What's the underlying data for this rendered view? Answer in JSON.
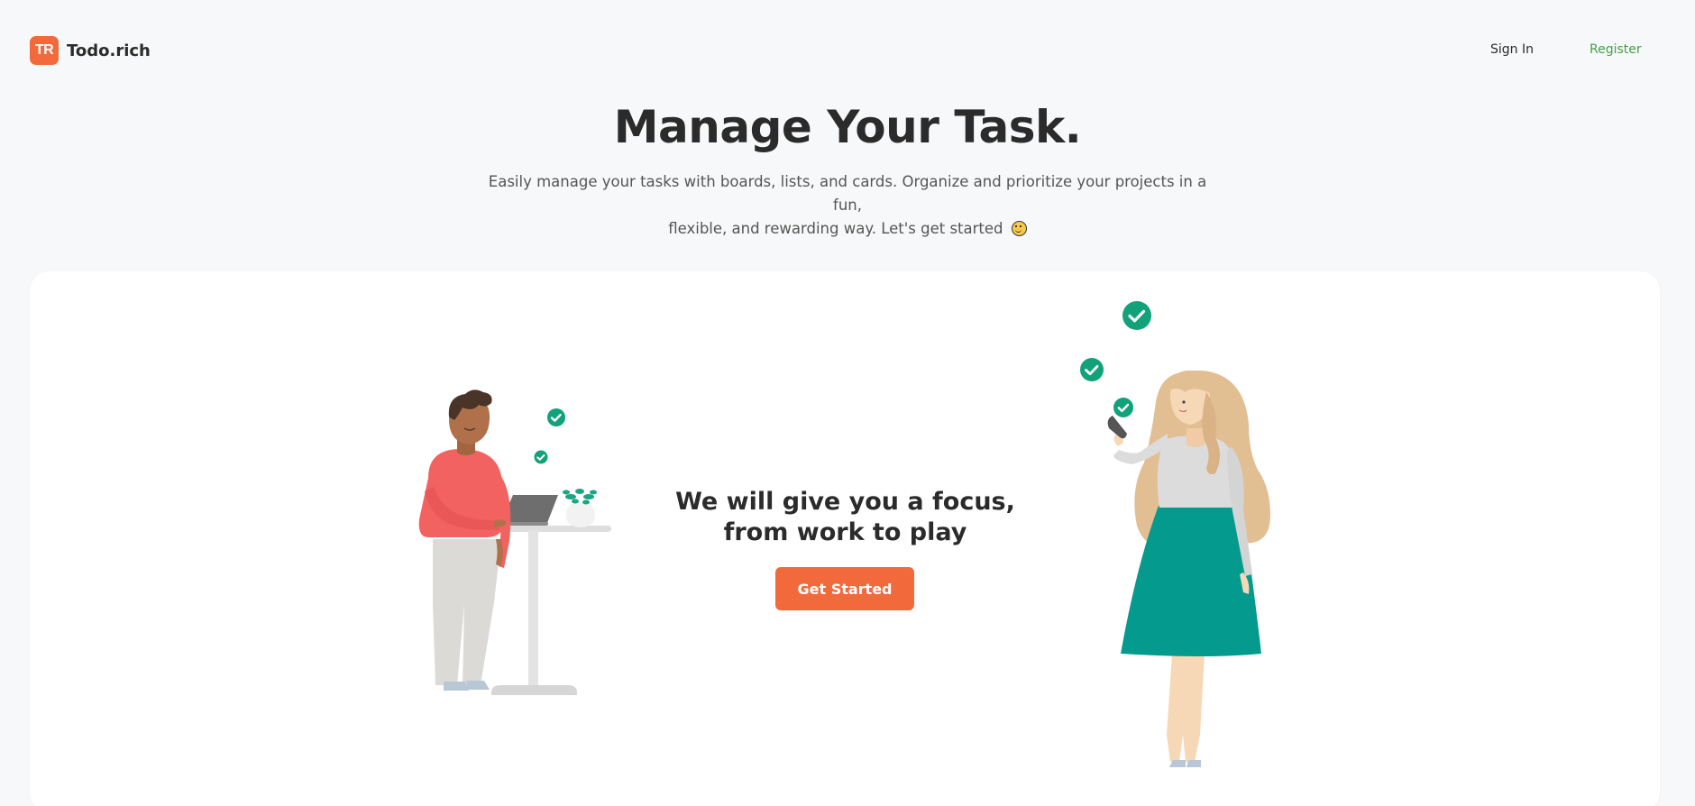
{
  "header": {
    "logo_badge": "TR",
    "brand": "Todo.rich",
    "nav": {
      "sign_in": "Sign In",
      "register": "Register"
    }
  },
  "hero": {
    "title": "Manage Your Task.",
    "subtitle_line1": "Easily manage your tasks with boards, lists, and cards. Organize and prioritize your projects in a fun,",
    "subtitle_line2": "flexible, and rewarding way. Let's get started"
  },
  "card": {
    "tagline_line1": "We will give you a focus,",
    "tagline_line2": "from work to play",
    "cta_label": "Get Started"
  },
  "colors": {
    "brand_orange": "#f26a3b",
    "register_green": "#43a047",
    "check_green": "#12a27a",
    "background": "#f7f8f9"
  },
  "icons": [
    "logo-badge",
    "smile-emoji-icon",
    "check-circle-icon"
  ]
}
